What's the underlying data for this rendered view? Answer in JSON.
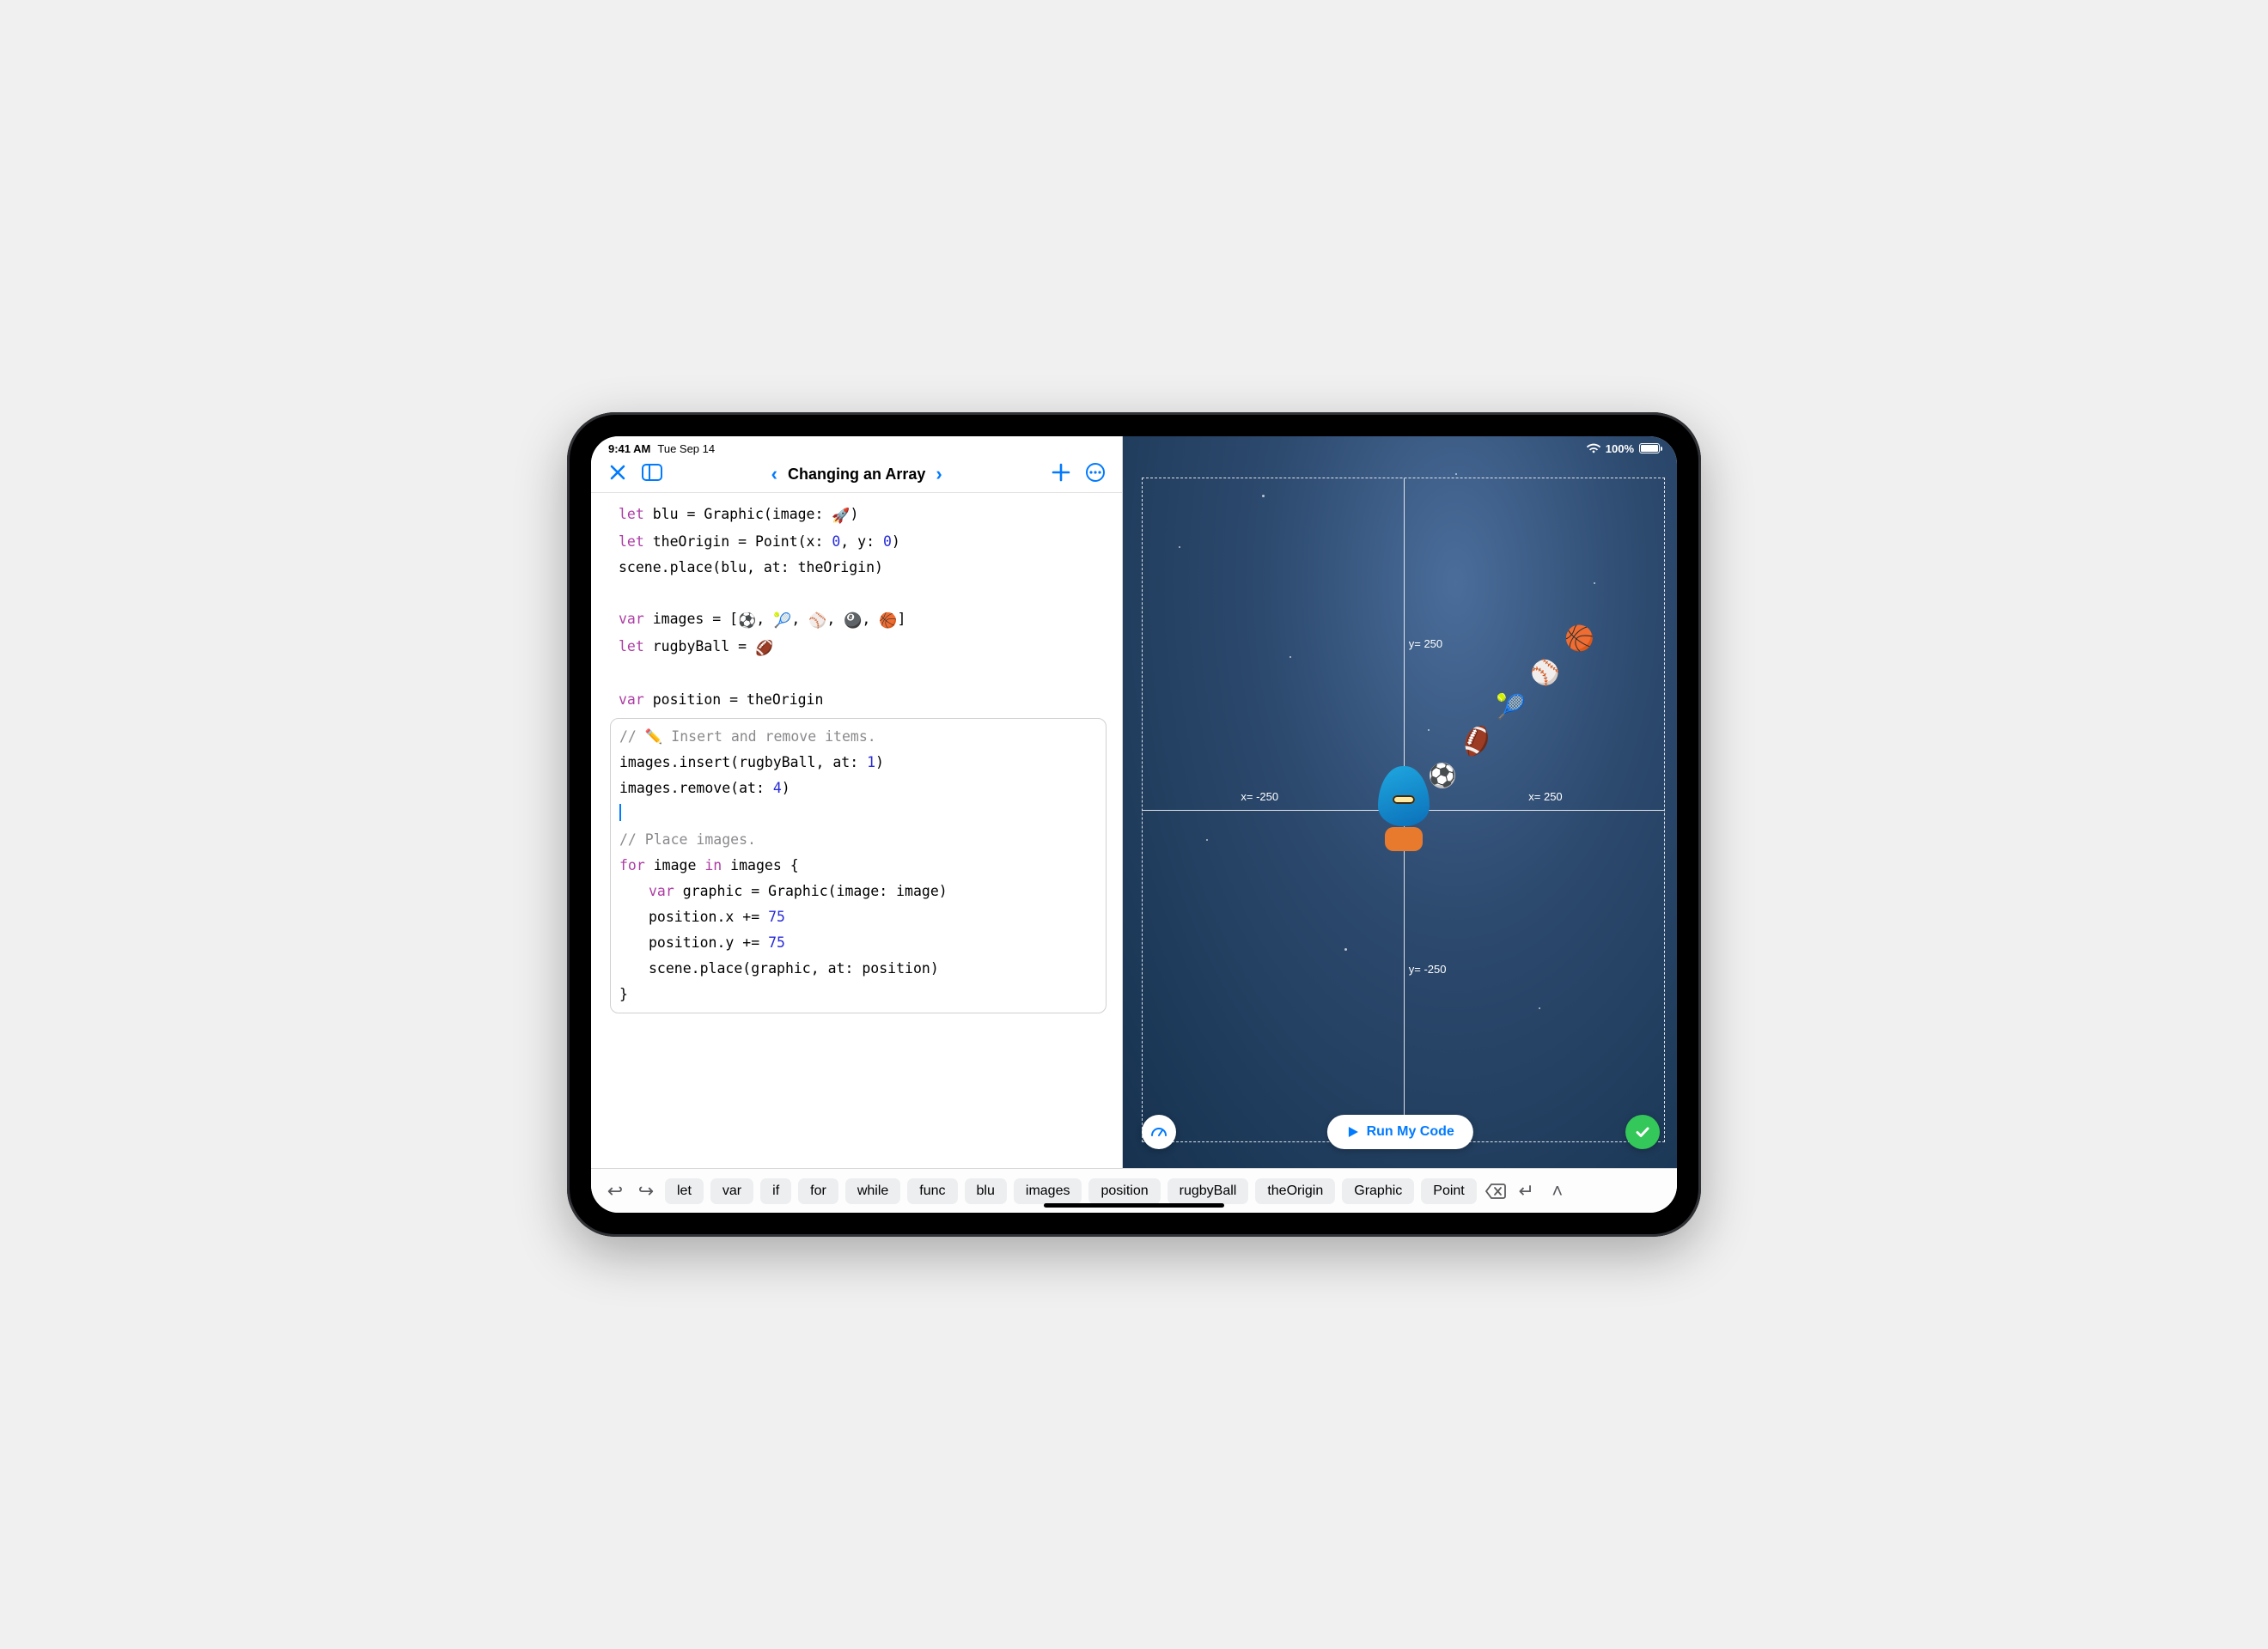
{
  "status": {
    "time": "9:41 AM",
    "date": "Tue Sep 14",
    "battery_pct": "100%"
  },
  "toolbar": {
    "title": "Changing an Array"
  },
  "code": {
    "l1a": "let",
    "l1b": " blu = Graphic(image: ",
    "l1c": ")",
    "l2a": "let",
    "l2b": " theOrigin = Point(x: ",
    "l2n1": "0",
    "l2c": ", y: ",
    "l2n2": "0",
    "l2d": ")",
    "l3": "scene.place(blu, at: theOrigin)",
    "l4a": "var",
    "l4b": " images = [",
    "l4sep": ", ",
    "l4c": "]",
    "l5a": "let",
    "l5b": " rugbyBall = ",
    "l6a": "var",
    "l6b": " position = theOrigin",
    "c1": "// ✏️ Insert and remove items.",
    "e1a": "images.insert(rugbyBall, at: ",
    "e1n": "1",
    "e1b": ")",
    "e2a": "images.remove(at: ",
    "e2n": "4",
    "e2b": ")",
    "c2": "// Place images.",
    "f1a": "for",
    "f1b": " image ",
    "f1c": "in",
    "f1d": " images {",
    "f2a": "var",
    "f2b": " graphic = Graphic(image: image)",
    "f3a": "position.x += ",
    "f3n": "75",
    "f4a": "position.y += ",
    "f4n": "75",
    "f5": "scene.place(graphic, at: position)",
    "f6": "}"
  },
  "scene": {
    "labels": {
      "yPos": "y= 250",
      "yNeg": "y= -250",
      "xPos": "x= 250",
      "xNeg": "x= -250"
    },
    "run_label": "Run My Code"
  },
  "shortcuts": [
    "let",
    "var",
    "if",
    "for",
    "while",
    "func",
    "blu",
    "images",
    "position",
    "rugbyBall",
    "theOrigin",
    "Graphic",
    "Point"
  ]
}
